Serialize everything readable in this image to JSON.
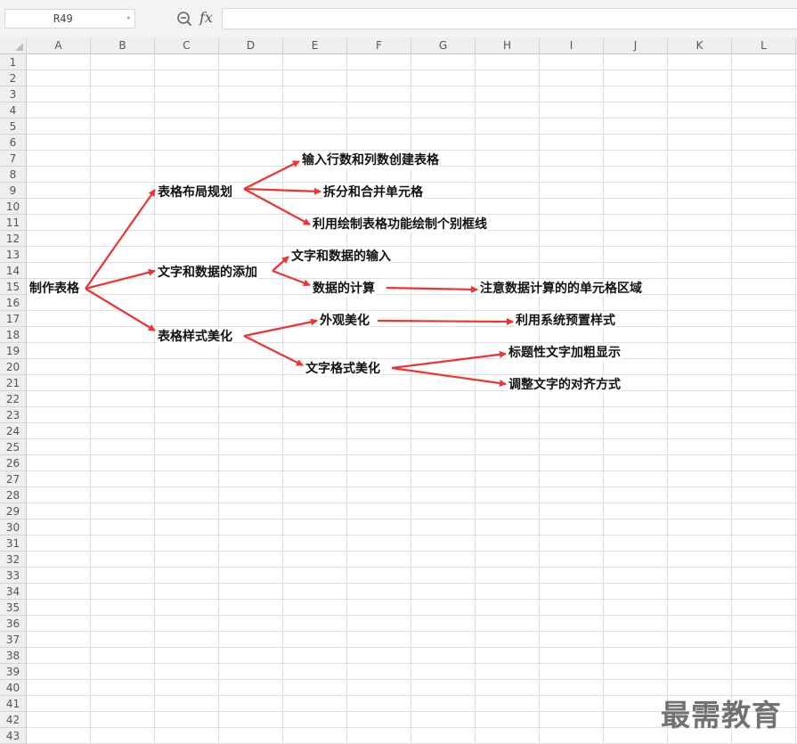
{
  "namebox": {
    "cell_ref": "R49"
  },
  "formula_bar": {
    "fx_label": "fx",
    "zoom_icon": "zoom-out-icon",
    "formula": ""
  },
  "columns": [
    "A",
    "B",
    "C",
    "D",
    "E",
    "F",
    "G",
    "H",
    "I",
    "J",
    "K",
    "L"
  ],
  "rows": [
    "1",
    "2",
    "3",
    "4",
    "5",
    "6",
    "7",
    "8",
    "9",
    "10",
    "11",
    "12",
    "13",
    "14",
    "15",
    "16",
    "17",
    "18",
    "19",
    "20",
    "21",
    "22",
    "23",
    "24",
    "25",
    "26",
    "27",
    "28",
    "29",
    "30",
    "31",
    "32",
    "33",
    "34",
    "35",
    "36",
    "37",
    "38",
    "39",
    "40",
    "41",
    "42",
    "43"
  ],
  "colors": {
    "arrow": "#ee3333",
    "grid_line": "#dfdfdf",
    "header_bg": "#efefef"
  },
  "mindmap": {
    "root": "制作表格",
    "n_layout": "表格布局规划",
    "n_layout_1": "输入行数和列数创建表格",
    "n_layout_2": "拆分和合并单元格",
    "n_layout_3": "利用绘制表格功能绘制个别框线",
    "n_text": "文字和数据的添加",
    "n_text_1": "文字和数据的输入",
    "n_text_2": "数据的计算",
    "n_text_2_1": "注意数据计算的的单元格区域",
    "n_style": "表格样式美化",
    "n_style_1": "外观美化",
    "n_style_1_1": "利用系统预置样式",
    "n_style_2": "文字格式美化",
    "n_style_2_1": "标题性文字加粗显示",
    "n_style_2_2": "调整文字的对齐方式"
  },
  "watermark": "最需教育"
}
